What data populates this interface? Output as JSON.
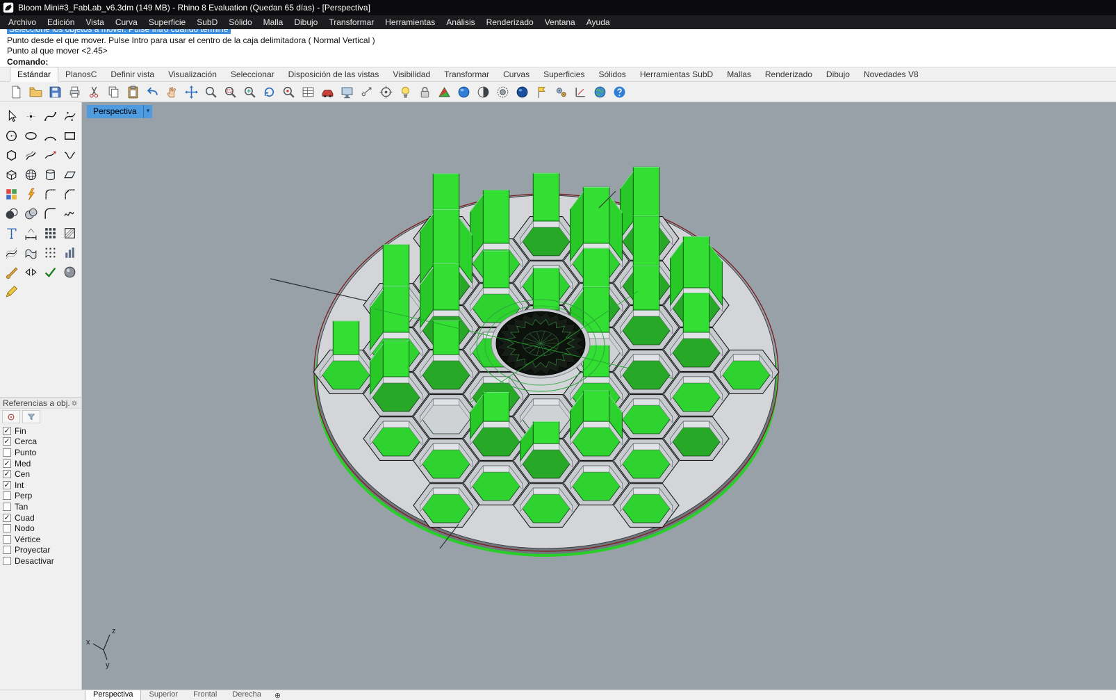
{
  "window": {
    "title": "Bloom Mini#3_FabLab_v6.3dm (149 MB) - Rhino 8 Evaluation (Quedan 65 días) - [Perspectiva]"
  },
  "menu": {
    "items": [
      "Archivo",
      "Edición",
      "Vista",
      "Curva",
      "Superficie",
      "SubD",
      "Sólido",
      "Malla",
      "Dibujo",
      "Transformar",
      "Herramientas",
      "Análisis",
      "Renderizado",
      "Ventana",
      "Ayuda"
    ]
  },
  "command": {
    "history_selected": "Seleccione los objetos a mover. Pulse Intro cuando termine",
    "line1": "Punto desde el que mover. Pulse Intro para usar el centro de la caja delimitadora ( Normal  Vertical )",
    "line2": "Punto al que mover <2.45>",
    "prompt": "Comando:"
  },
  "toolbar_tabs": {
    "active": "Estándar",
    "items": [
      "Estándar",
      "PlanosC",
      "Definir vista",
      "Visualización",
      "Seleccionar",
      "Disposición de las vistas",
      "Visibilidad",
      "Transformar",
      "Curvas",
      "Superficies",
      "Sólidos",
      "Herramientas SubD",
      "Mallas",
      "Renderizado",
      "Dibujo",
      "Novedades V8"
    ]
  },
  "main_toolbar": {
    "icons": [
      "new-file",
      "open-file",
      "save",
      "print",
      "cut",
      "copy",
      "paste",
      "undo",
      "pan-view",
      "move",
      "zoom-dynamic",
      "zoom-window",
      "zoom-extents",
      "rotate-view",
      "zoom-selected",
      "layers-table",
      "car-display",
      "monitor-view",
      "point-filter",
      "target-osnap",
      "lightbulb",
      "lock",
      "shade-view",
      "render-circle",
      "render-half",
      "raytrace",
      "material-sphere",
      "flag",
      "options-gears",
      "scale-tool",
      "earth-geolocation",
      "help"
    ]
  },
  "tool_palette": {
    "icons": [
      "select-arrow",
      "point",
      "curve-interpolated",
      "curve-control-points",
      "circle",
      "ellipse",
      "arc",
      "rectangle",
      "polygon",
      "offset-curve",
      "extend-curve",
      "blend-curve",
      "box",
      "sphere",
      "cylinder",
      "plane-surface",
      "plugins",
      "explode",
      "fillet-edge",
      "chamfer-edge",
      "boolean-difference",
      "boolean-union",
      "fillet-curve",
      "freeform-curve",
      "text",
      "dimension",
      "array-rectangular",
      "hatch",
      "surface-grid",
      "drape-surface",
      "point-grid",
      "bar-column",
      "paintbrush",
      "mirror",
      "check-selection",
      "shaded-sphere",
      "sweep-pencil"
    ]
  },
  "osnap": {
    "title": "Referencias a obj...",
    "check_glyph": "✓",
    "items": [
      {
        "label": "Fin",
        "checked": true
      },
      {
        "label": "Cerca",
        "checked": true
      },
      {
        "label": "Punto",
        "checked": false
      },
      {
        "label": "Med",
        "checked": true
      },
      {
        "label": "Cen",
        "checked": true
      },
      {
        "label": "Int",
        "checked": true
      },
      {
        "label": "Perp",
        "checked": false
      },
      {
        "label": "Tan",
        "checked": false
      },
      {
        "label": "Cuad",
        "checked": true
      },
      {
        "label": "Nodo",
        "checked": false
      },
      {
        "label": "Vértice",
        "checked": false
      },
      {
        "label": "Proyectar",
        "checked": false
      },
      {
        "label": "Desactivar",
        "checked": false
      }
    ]
  },
  "viewport": {
    "label": "Perspectiva",
    "menu_arrow": "▾",
    "axis": {
      "x": "x",
      "y": "y",
      "z": "z"
    }
  },
  "viewport_tabs": {
    "active": "Perspectiva",
    "add_icon": "⊕",
    "items": [
      "Perspectiva",
      "Superior",
      "Frontal",
      "Derecha"
    ]
  }
}
